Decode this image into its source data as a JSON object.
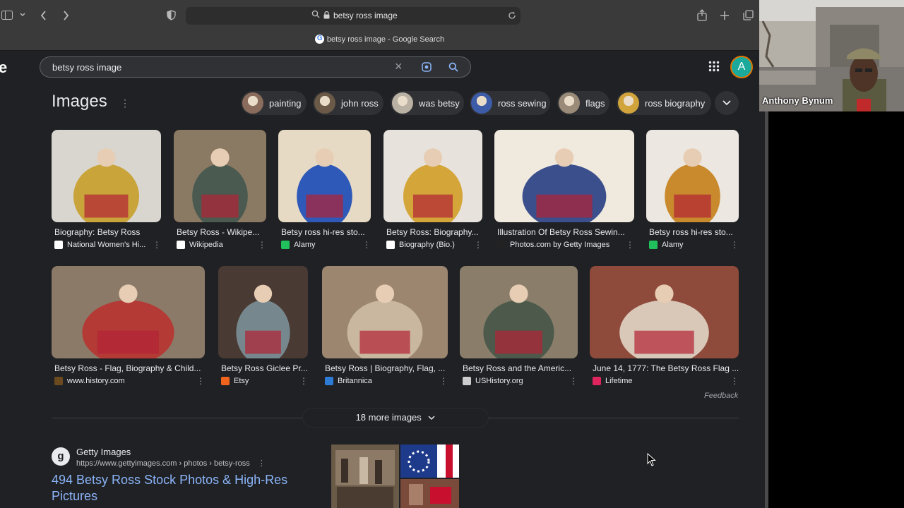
{
  "browser": {
    "url": "betsy ross image",
    "tab_title": "betsy ross image - Google Search"
  },
  "search": {
    "query": "betsy ross image",
    "logo_fragment": "e",
    "avatar_letter": "A"
  },
  "images_section": {
    "title": "Images",
    "chips": [
      {
        "label": "painting",
        "color": "#8a6c5c"
      },
      {
        "label": "john ross",
        "color": "#6b5a48"
      },
      {
        "label": "was betsy",
        "color": "#b9b1a3"
      },
      {
        "label": "ross sewing",
        "color": "#3d5ca8"
      },
      {
        "label": "flags",
        "color": "#9a8a78"
      },
      {
        "label": "ross biography",
        "color": "#d1a33b"
      }
    ],
    "row1": [
      {
        "title": "Biography: Betsy Ross",
        "source": "National Women's Hi...",
        "fav_color": "#ffffff",
        "bg": "#d9d6cf",
        "fg": "#c9a43a"
      },
      {
        "title": "Betsy Ross - Wikipe...",
        "source": "Wikipedia",
        "fav_color": "#ffffff",
        "bg": "#8b7a63",
        "fg": "#4a5a50"
      },
      {
        "title": "Betsy ross hi-res sto...",
        "source": "Alamy",
        "fav_color": "#20c05c",
        "bg": "#e6dac4",
        "fg": "#2e59b8"
      },
      {
        "title": "Betsy Ross: Biography...",
        "source": "Biography (Bio.)",
        "fav_color": "#ffffff",
        "bg": "#e7e2dc",
        "fg": "#d4a63a"
      },
      {
        "title": "Illustration Of Betsy Ross Sewin...",
        "source": "Photos.com by Getty Images",
        "fav_color": "#222222",
        "bg": "#efe9de",
        "fg": "#3a4f8c"
      },
      {
        "title": "Betsy ross hi-res sto...",
        "source": "Alamy",
        "fav_color": "#20c05c",
        "bg": "#ece7e0",
        "fg": "#c98a2e"
      }
    ],
    "row2": [
      {
        "title": "Betsy Ross - Flag, Biography & Child...",
        "source": "www.history.com",
        "fav_color": "#6b4a1f",
        "bg": "#8c7a68",
        "fg": "#b43a36"
      },
      {
        "title": "Betsy Ross Giclee Pr...",
        "source": "Etsy",
        "fav_color": "#f1641e",
        "bg": "#4a3a34",
        "fg": "#76888e"
      },
      {
        "title": "Betsy Ross | Biography, Flag, ...",
        "source": "Britannica",
        "fav_color": "#2e7bd6",
        "bg": "#9c8670",
        "fg": "#c9b7a0"
      },
      {
        "title": "Betsy Ross and the Americ...",
        "source": "USHistory.org",
        "fav_color": "#cccccc",
        "bg": "#8a7e6a",
        "fg": "#4d5a4b"
      },
      {
        "title": "June 14, 1777: The Betsy Ross Flag ...",
        "source": "Lifetime",
        "fav_color": "#e0245e",
        "bg": "#8e4a3a",
        "fg": "#d9c7b8"
      }
    ],
    "feedback": "Feedback",
    "more_images": "18 more images"
  },
  "result": {
    "site_name": "Getty Images",
    "site_url": "https://www.gettyimages.com › photos › betsy-ross",
    "title": "494 Betsy Ross Stock Photos & High-Res Pictures",
    "fav_letter": "g"
  },
  "webcam": {
    "name": "Anthony Bynum"
  }
}
